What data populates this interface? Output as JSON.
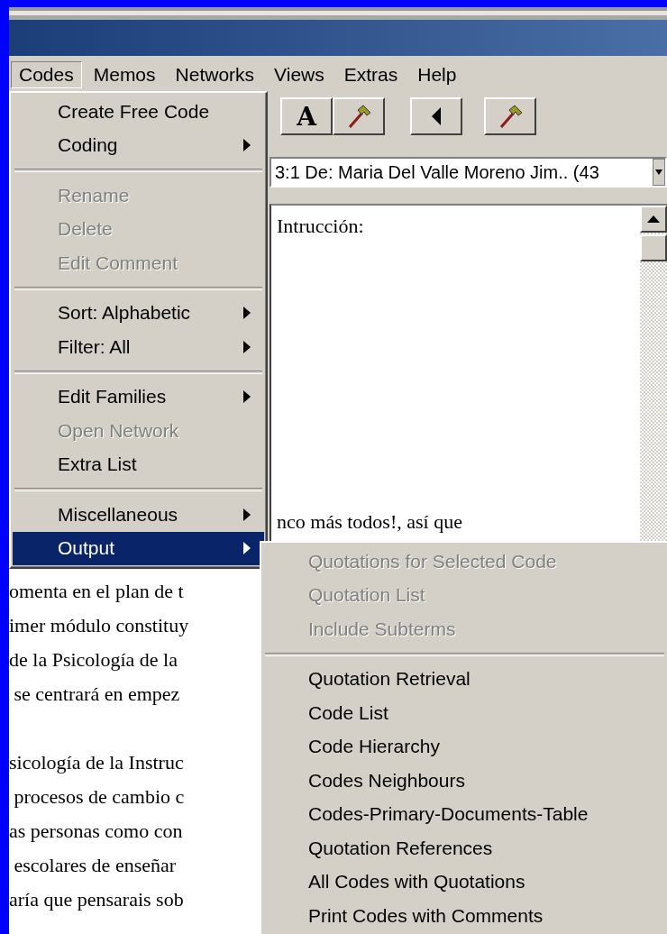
{
  "menubar": [
    {
      "label": "Codes",
      "selected": true
    },
    {
      "label": "Memos",
      "selected": false
    },
    {
      "label": "Networks",
      "selected": false
    },
    {
      "label": "Views",
      "selected": false
    },
    {
      "label": "Extras",
      "selected": false
    },
    {
      "label": "Help",
      "selected": false
    }
  ],
  "toolbar": [
    {
      "kind": "letter",
      "label": "A"
    },
    {
      "kind": "hammer"
    },
    {
      "kind": "back"
    },
    {
      "kind": "hammer"
    }
  ],
  "document_selector": {
    "value": "3:1 De: Maria Del Valle Moreno Jim.. (43"
  },
  "document": {
    "heading": "Intrucción:",
    "line_right": "nco más todos!, así que",
    "paragraphs_left": [
      [
        "omenta en el plan de t",
        "imer módulo constituy",
        "de la Psicología de la",
        " se centrará en empez"
      ],
      [
        "sicología de la Instruc",
        " procesos de cambio c",
        "as personas como con",
        " escolares de enseñar",
        "aría que pensarais sob"
      ]
    ]
  },
  "codes_menu": [
    {
      "kind": "item",
      "label": "Create Free Code",
      "disabled": false,
      "submenu": false,
      "selected": false
    },
    {
      "kind": "item",
      "label": "Coding",
      "disabled": false,
      "submenu": true,
      "selected": false
    },
    {
      "kind": "separator"
    },
    {
      "kind": "item",
      "label": "Rename",
      "disabled": true,
      "submenu": false,
      "selected": false
    },
    {
      "kind": "item",
      "label": "Delete",
      "disabled": true,
      "submenu": false,
      "selected": false
    },
    {
      "kind": "item",
      "label": "Edit Comment",
      "disabled": true,
      "submenu": false,
      "selected": false
    },
    {
      "kind": "separator"
    },
    {
      "kind": "item",
      "label": "Sort: Alphabetic",
      "disabled": false,
      "submenu": true,
      "selected": false
    },
    {
      "kind": "item",
      "label": "Filter: All",
      "disabled": false,
      "submenu": true,
      "selected": false
    },
    {
      "kind": "separator"
    },
    {
      "kind": "item",
      "label": "Edit Families",
      "disabled": false,
      "submenu": true,
      "selected": false
    },
    {
      "kind": "item",
      "label": "Open Network",
      "disabled": true,
      "submenu": false,
      "selected": false
    },
    {
      "kind": "item",
      "label": "Extra List",
      "disabled": false,
      "submenu": false,
      "selected": false
    },
    {
      "kind": "separator"
    },
    {
      "kind": "item",
      "label": "Miscellaneous",
      "disabled": false,
      "submenu": true,
      "selected": false
    },
    {
      "kind": "item",
      "label": "Output",
      "disabled": false,
      "submenu": true,
      "selected": true
    }
  ],
  "output_submenu": [
    {
      "kind": "item",
      "label": "Quotations for Selected Code",
      "disabled": true
    },
    {
      "kind": "item",
      "label": "Quotation List",
      "disabled": true
    },
    {
      "kind": "item",
      "label": "Include Subterms",
      "disabled": true
    },
    {
      "kind": "separator"
    },
    {
      "kind": "item",
      "label": "Quotation Retrieval",
      "disabled": false
    },
    {
      "kind": "item",
      "label": "Code List",
      "disabled": false
    },
    {
      "kind": "item",
      "label": "Code Hierarchy",
      "disabled": false
    },
    {
      "kind": "item",
      "label": "Codes Neighbours",
      "disabled": false
    },
    {
      "kind": "item",
      "label": "Codes-Primary-Documents-Table",
      "disabled": false
    },
    {
      "kind": "item",
      "label": "Quotation References",
      "disabled": false
    },
    {
      "kind": "item",
      "label": "All Codes with Quotations",
      "disabled": false
    },
    {
      "kind": "item",
      "label": "Print Codes with Comments",
      "disabled": false
    }
  ]
}
